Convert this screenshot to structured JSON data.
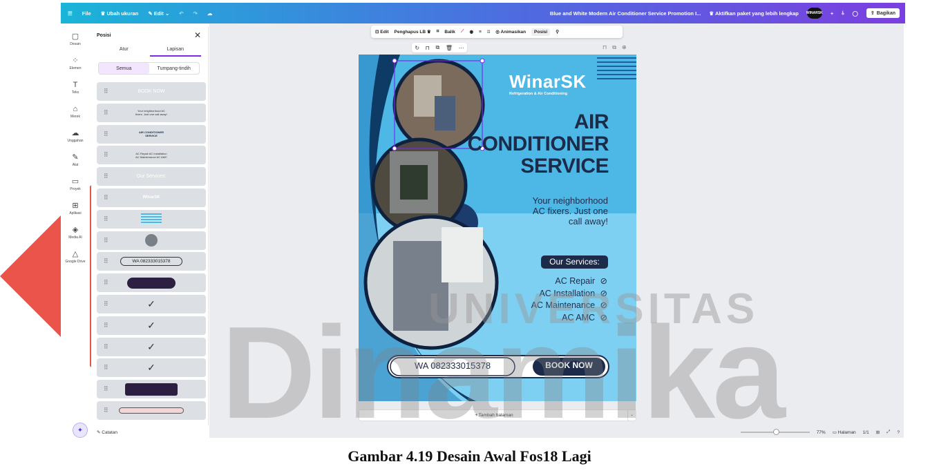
{
  "topbar": {
    "file": "File",
    "resize": "Ubah ukuran",
    "edit": "Edit",
    "doc_title": "Blue and White Modern Air Conditioner Service Promotion I...",
    "upgrade": "Aktifkan paket yang lebih lengkap",
    "avatar_text": "WINARSK",
    "share": "Bagikan"
  },
  "leftnav": [
    {
      "label": "Desain",
      "icon": "layout-icon",
      "glyph": "▢"
    },
    {
      "label": "Elemen",
      "icon": "shapes-icon",
      "glyph": "⁘"
    },
    {
      "label": "Teks",
      "icon": "text-icon",
      "glyph": "T"
    },
    {
      "label": "Merek",
      "icon": "brand-icon",
      "glyph": "⌂"
    },
    {
      "label": "Unggahan",
      "icon": "upload-icon",
      "glyph": "☁"
    },
    {
      "label": "Alat",
      "icon": "draw-icon",
      "glyph": "✎"
    },
    {
      "label": "Proyek",
      "icon": "folder-icon",
      "glyph": "▭"
    },
    {
      "label": "Aplikasi",
      "icon": "apps-icon",
      "glyph": "⊞"
    },
    {
      "label": "Media AI",
      "icon": "ai-media-icon",
      "glyph": "◈"
    },
    {
      "label": "Google Drive",
      "icon": "google-drive-icon",
      "glyph": "△"
    }
  ],
  "panel": {
    "title": "Posisi",
    "tab_arrange": "Atur",
    "tab_layers": "Lapisan",
    "seg_all": "Semua",
    "seg_overlap": "Tumpang-tindih",
    "layers": [
      {
        "preview": "BOOK NOW",
        "kind": "text"
      },
      {
        "preview": "Your neighborhood AC fixers. Just one call away!",
        "kind": "small"
      },
      {
        "preview": "AIR CONDITIONER SERVICE",
        "kind": "dark"
      },
      {
        "preview": "AC Repair AC Installation AC Maintenance AC AMC",
        "kind": "small"
      },
      {
        "preview": "Our Services:",
        "kind": "text"
      },
      {
        "preview": "WinarSK",
        "kind": "logo"
      },
      {
        "preview": "",
        "kind": "stripes"
      },
      {
        "preview": "",
        "kind": "circle"
      },
      {
        "preview": "WA 082333015378",
        "kind": "pill"
      },
      {
        "preview": "",
        "kind": "darkpill"
      },
      {
        "preview": "",
        "kind": "check"
      },
      {
        "preview": "",
        "kind": "check"
      },
      {
        "preview": "",
        "kind": "check"
      },
      {
        "preview": "",
        "kind": "check"
      },
      {
        "preview": "",
        "kind": "darkrect"
      },
      {
        "preview": "",
        "kind": "outline"
      }
    ]
  },
  "ctxbar": {
    "edit": "Edit",
    "bg_remove": "Penghapus LB",
    "flip": "Balik",
    "animate": "Animasikan",
    "position": "Posisi"
  },
  "poster": {
    "brand": "WinarSK",
    "brand_sub": "Refrigeration & Air Conditioning",
    "headline_1": "AIR",
    "headline_2": "CONDITIONER",
    "headline_3": "SERVICE",
    "tagline_1": "Your neighborhood",
    "tagline_2": "AC fixers. Just one",
    "tagline_3": "call away!",
    "services_title": "Our Services:",
    "services": [
      "AC Repair",
      "AC Installation",
      "AC Maintenance",
      "AC AMC"
    ],
    "wa": "WA 082333015378",
    "book": "BOOK NOW"
  },
  "add_page": "+ Tambah halaman",
  "status": {
    "notes": "Catatan",
    "zoom": "77%",
    "pages_label": "Halaman",
    "pages": "1/1"
  },
  "watermark": {
    "univ": "UNIVERSITAS",
    "name": "Dinamika"
  },
  "caption": "Gambar 4.19 Desain Awal Fos18 Lagi",
  "colors": {
    "poster_bg": "#7ed0f2",
    "poster_dark": "#1c2b4a",
    "accent_purple": "#7d2ae8",
    "watermark_red": "#e8362b"
  }
}
